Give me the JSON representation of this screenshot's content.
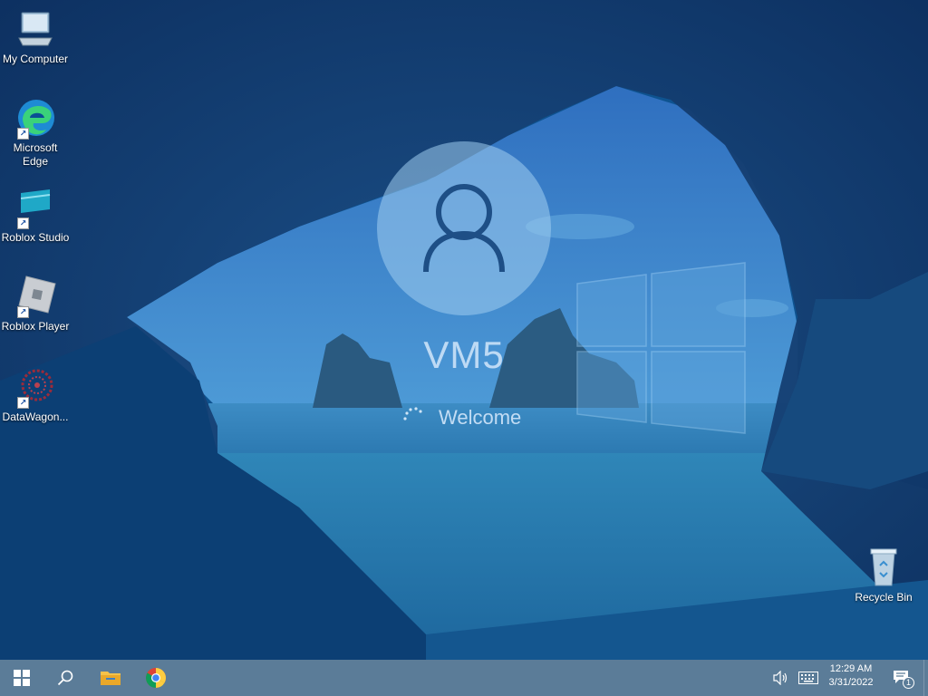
{
  "desktop": {
    "icons": [
      {
        "label": "My Computer",
        "icon": "computer-icon",
        "shortcut": false
      },
      {
        "label": "Microsoft Edge",
        "icon": "edge-icon",
        "shortcut": true
      },
      {
        "label": "Roblox Studio",
        "icon": "roblox-studio-icon",
        "shortcut": true
      },
      {
        "label": "Roblox Player",
        "icon": "roblox-player-icon",
        "shortcut": true
      },
      {
        "label": "DataWagon...",
        "icon": "datawagon-icon",
        "shortcut": true
      },
      {
        "label": "Recycle Bin",
        "icon": "recycle-bin-icon",
        "shortcut": false
      }
    ]
  },
  "login": {
    "username": "VM5",
    "status": "Welcome"
  },
  "taskbar": {
    "pinned": [
      {
        "name": "start",
        "icon": "windows-logo-icon"
      },
      {
        "name": "search",
        "icon": "search-icon"
      },
      {
        "name": "file-explorer",
        "icon": "folder-icon"
      },
      {
        "name": "chrome",
        "icon": "chrome-icon"
      }
    ],
    "tray": {
      "volume_icon": "speaker-icon",
      "keyboard_icon": "keyboard-icon",
      "time": "12:29 AM",
      "date": "3/31/2022",
      "notification_icon": "action-center-icon",
      "notification_count": "1"
    }
  },
  "colors": {
    "overlay_blue": "#0d5a93",
    "taskbar": "#5b7c98"
  }
}
